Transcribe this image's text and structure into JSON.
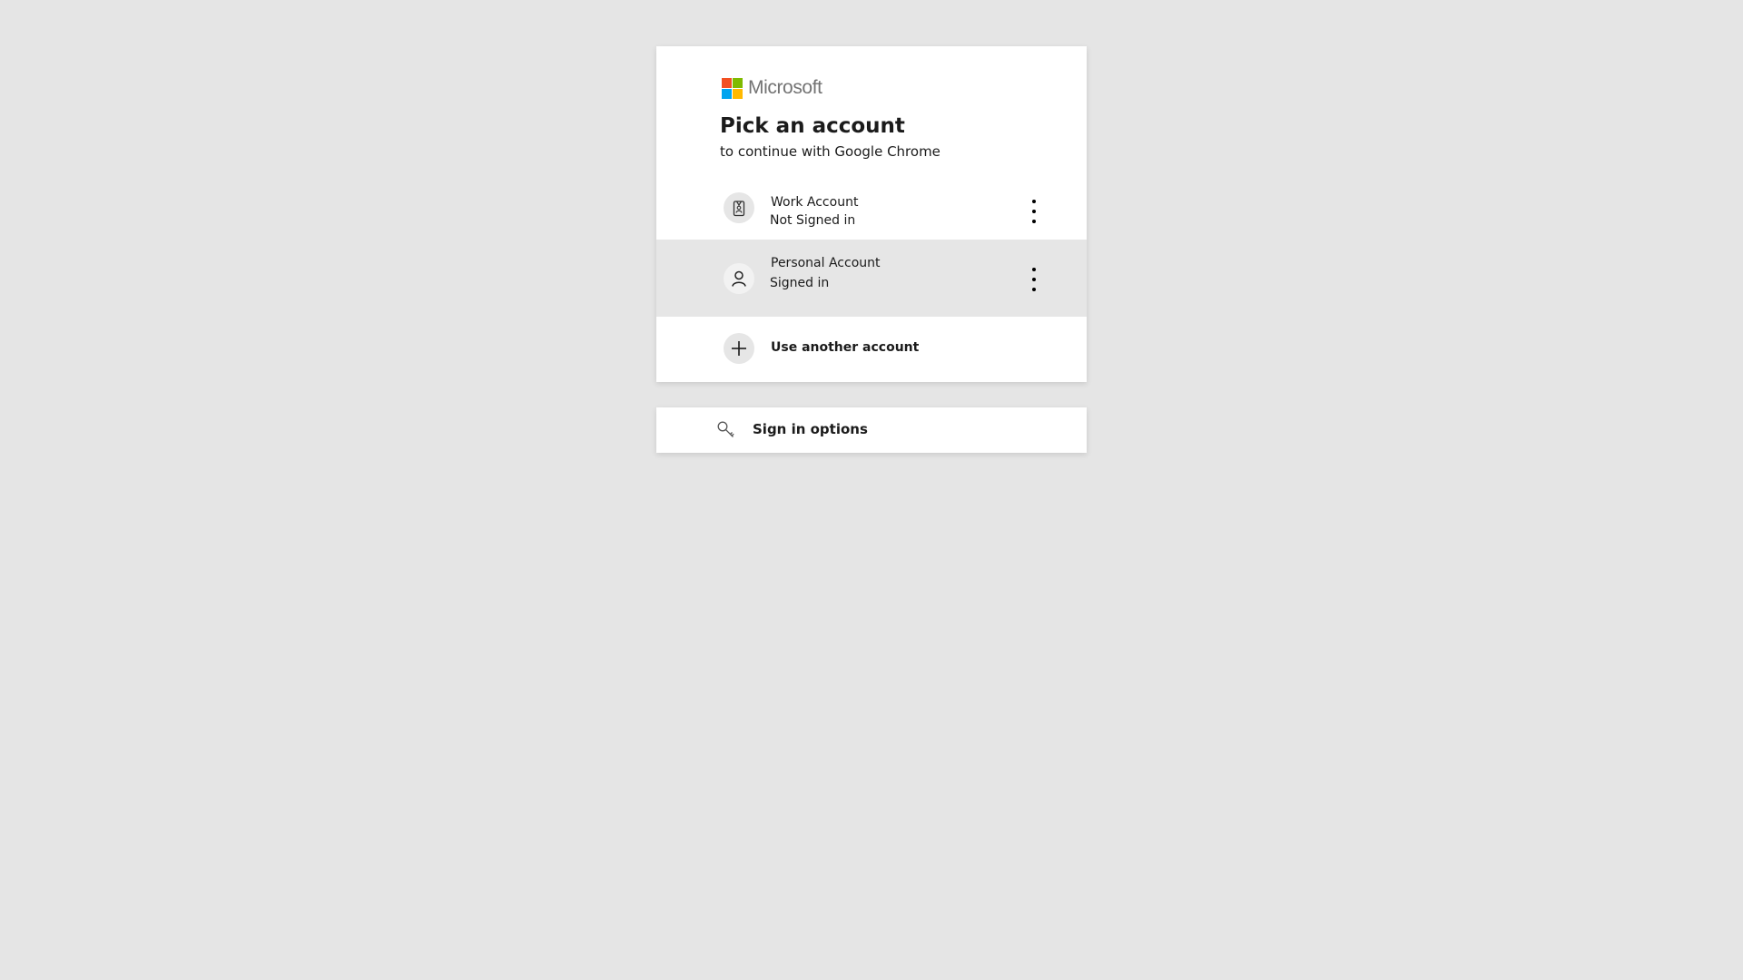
{
  "logo": {
    "text": "Microsoft",
    "colors": [
      "#f25022",
      "#7fba00",
      "#00a4ef",
      "#ffb900"
    ]
  },
  "header": {
    "title": "Pick an account",
    "subtitle": "to continue with Google Chrome"
  },
  "accounts": [
    {
      "name": "Work Account",
      "status": "Not Signed in",
      "icon": "badge-icon",
      "more_icon": "more-options-icon"
    },
    {
      "name": "Personal Account",
      "status": "Signed in",
      "icon": "person-icon",
      "more_icon": "more-options-icon",
      "highlighted": true
    }
  ],
  "use_another": {
    "label": "Use another account",
    "icon": "plus-icon"
  },
  "sign_in_options": {
    "label": "Sign in options",
    "icon": "key-icon"
  },
  "colors": {
    "background": "#e5e5e5",
    "card": "#ffffff",
    "row_highlight": "#e6e6e6",
    "text": "#1b1b1b"
  }
}
